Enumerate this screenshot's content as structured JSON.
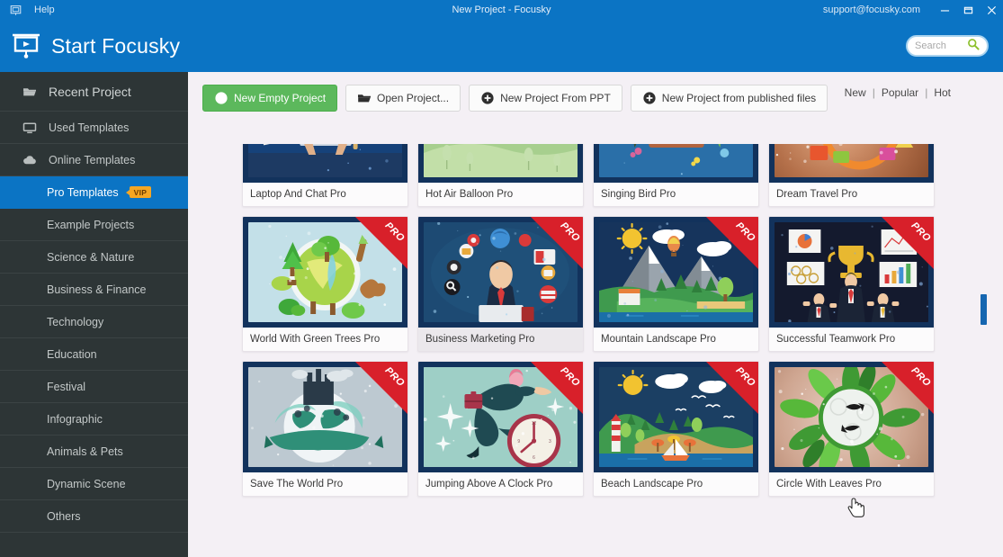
{
  "titlebar": {
    "app_icon": "presentation-icon",
    "help_label": "Help",
    "window_title": "New Project - Focusky",
    "support_email": "support@focusky.com",
    "minimize_label": "—",
    "maximize_label": "❐",
    "close_label": "✕"
  },
  "header": {
    "brand_icon": "presentation-screen-icon",
    "brand_text": "Start Focusky",
    "search": {
      "placeholder": "Search",
      "value": "",
      "icon": "search-icon"
    }
  },
  "sidebar": {
    "items": [
      {
        "label": "Recent Project",
        "icon": "folder-open-icon",
        "active": false,
        "indent": false,
        "tall": true
      },
      {
        "label": "Used Templates",
        "icon": "monitor-icon",
        "active": false,
        "indent": false,
        "tall": false
      },
      {
        "label": "Online Templates",
        "icon": "cloud-icon",
        "active": false,
        "indent": false,
        "tall": false
      },
      {
        "label": "Pro Templates",
        "icon": "",
        "active": true,
        "indent": true,
        "tall": false,
        "badge": "VIP"
      },
      {
        "label": "Example Projects",
        "icon": "",
        "active": false,
        "indent": true,
        "tall": false
      },
      {
        "label": "Science & Nature",
        "icon": "",
        "active": false,
        "indent": true,
        "tall": false
      },
      {
        "label": "Business & Finance",
        "icon": "",
        "active": false,
        "indent": true,
        "tall": false
      },
      {
        "label": "Technology",
        "icon": "",
        "active": false,
        "indent": true,
        "tall": false
      },
      {
        "label": "Education",
        "icon": "",
        "active": false,
        "indent": true,
        "tall": false
      },
      {
        "label": "Festival",
        "icon": "",
        "active": false,
        "indent": true,
        "tall": false
      },
      {
        "label": "Infographic",
        "icon": "",
        "active": false,
        "indent": true,
        "tall": false
      },
      {
        "label": "Animals & Pets",
        "icon": "",
        "active": false,
        "indent": true,
        "tall": false
      },
      {
        "label": "Dynamic Scene",
        "icon": "",
        "active": false,
        "indent": true,
        "tall": false
      },
      {
        "label": "Others",
        "icon": "",
        "active": false,
        "indent": true,
        "tall": false
      }
    ]
  },
  "toolbar": {
    "buttons": [
      {
        "label": "New Empty Project",
        "icon": "plus-circle-icon",
        "primary": true
      },
      {
        "label": "Open Project...",
        "icon": "folder-open-icon",
        "primary": false
      },
      {
        "label": "New Project From PPT",
        "icon": "plus-circle-icon",
        "primary": false
      },
      {
        "label": "New Project from published files",
        "icon": "plus-circle-icon",
        "primary": false
      }
    ],
    "sorters": [
      "New",
      "Popular",
      "Hot"
    ],
    "sorter_separator": "|"
  },
  "templates": {
    "pro_badge_label": "PRO",
    "cards": [
      {
        "label": "Laptop And Chat Pro",
        "pro": false,
        "art": "laptop-chat",
        "hover": false
      },
      {
        "label": "Hot Air Balloon Pro",
        "pro": false,
        "art": "hot-air-balloon",
        "hover": false
      },
      {
        "label": "Singing Bird Pro",
        "pro": false,
        "art": "singing-bird",
        "hover": false
      },
      {
        "label": "Dream Travel Pro",
        "pro": false,
        "art": "dream-travel",
        "hover": false
      },
      {
        "label": "World With Green Trees Pro",
        "pro": true,
        "art": "green-world",
        "hover": false
      },
      {
        "label": "Business Marketing Pro",
        "pro": true,
        "art": "business-marketing",
        "hover": true
      },
      {
        "label": "Mountain Landscape Pro",
        "pro": true,
        "art": "mountain-landscape",
        "hover": false
      },
      {
        "label": "Successful Teamwork Pro",
        "pro": true,
        "art": "teamwork",
        "hover": false
      },
      {
        "label": "Save The World Pro",
        "pro": true,
        "art": "save-world",
        "hover": false
      },
      {
        "label": "Jumping Above A Clock Pro",
        "pro": true,
        "art": "jumping-clock",
        "hover": false
      },
      {
        "label": "Beach Landscape Pro",
        "pro": true,
        "art": "beach-landscape",
        "hover": false
      },
      {
        "label": "Circle With Leaves Pro",
        "pro": true,
        "art": "circle-leaves",
        "hover": false
      }
    ]
  },
  "colors": {
    "accent_blue": "#0b74c4",
    "sidebar_bg": "#2d3536",
    "pro_red": "#d8202a",
    "primary_green": "#5cb85c",
    "vip_orange": "#f5a623",
    "content_bg": "#f4f0f5"
  },
  "scrollbar": {
    "name": "vertical-scrollbar"
  },
  "cursor": {
    "name": "pointer-cursor"
  }
}
